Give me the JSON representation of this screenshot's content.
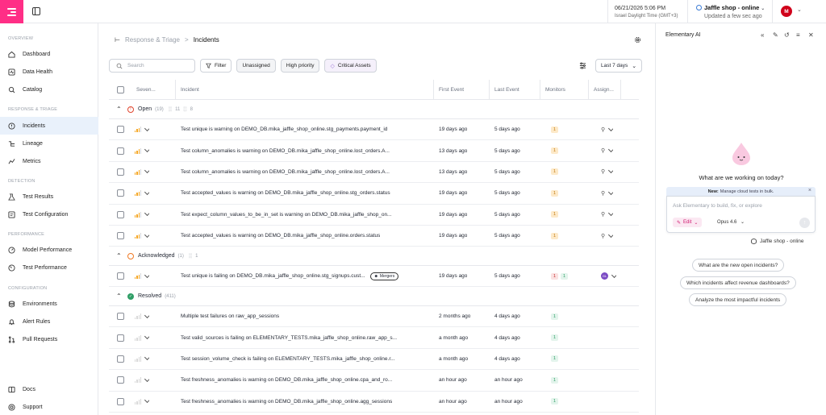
{
  "topbar": {
    "datetime": "06/21/2026 5:06 PM",
    "timezone": "Israel Daylight Time (GMT+3)",
    "env_name": "Jaffle shop - online",
    "env_updated": "Updated a few sec ago",
    "avatar_initial": "M"
  },
  "sidebar": {
    "sections": {
      "overview": "OVERVIEW",
      "response": "RESPONSE & TRIAGE",
      "detection": "DETECTION",
      "performance": "PERFORMANCE",
      "configuration": "CONFIGURATION"
    },
    "items": {
      "dashboard": "Dashboard",
      "data_health": "Data Health",
      "catalog": "Catalog",
      "incidents": "Incidents",
      "lineage": "Lineage",
      "metrics": "Metrics",
      "test_results": "Test Results",
      "test_configuration": "Test Configuration",
      "model_performance": "Model Performance",
      "test_performance": "Test Performance",
      "environments": "Environments",
      "alert_rules": "Alert Rules",
      "pull_requests": "Pull Requests",
      "docs": "Docs",
      "support": "Support"
    }
  },
  "breadcrumb": {
    "parent": "Response & Triage",
    "separator": ">",
    "current": "Incidents"
  },
  "filters": {
    "search_placeholder": "Search",
    "filter_label": "Filter",
    "unassigned": "Unassigned",
    "high_priority": "High priority",
    "critical_assets": "Critical Assets",
    "range": "Last 7 days"
  },
  "columns": {
    "severity": "Seven...",
    "incident": "Incident",
    "first_event": "First Event",
    "last_event": "Last Event",
    "monitors": "Monitors",
    "assignee": "Assign..."
  },
  "groups": {
    "open": {
      "label": "Open",
      "count": "(19)",
      "stat1": "11",
      "stat2": "8"
    },
    "acknowledged": {
      "label": "Acknowledged",
      "count": "(1)",
      "stat1": "1"
    },
    "resolved": {
      "label": "Resolved",
      "count": "(411)"
    }
  },
  "rows": [
    {
      "text": "Test unique is warning on DEMO_DB.mika_jaffle_shop_online.stg_payments.payment_id",
      "first": "19 days ago",
      "last": "5 days ago",
      "monitor": "1"
    },
    {
      "text": "Test column_anomalies is warning on DEMO_DB.mika_jaffle_shop_online.lost_orders.A...",
      "first": "13 days ago",
      "last": "5 days ago",
      "monitor": "1"
    },
    {
      "text": "Test column_anomalies is warning on DEMO_DB.mika_jaffle_shop_online.lost_orders.A...",
      "first": "13 days ago",
      "last": "5 days ago",
      "monitor": "1"
    },
    {
      "text": "Test accepted_values is warning on DEMO_DB.mika_jaffle_shop_online.stg_orders.status",
      "first": "19 days ago",
      "last": "5 days ago",
      "monitor": "1"
    },
    {
      "text": "Test expect_column_values_to_be_in_set is warning on DEMO_DB.mika_jaffle_shop_on...",
      "first": "19 days ago",
      "last": "5 days ago",
      "monitor": "1"
    },
    {
      "text": "Test accepted_values is warning on DEMO_DB.mika_jaffle_shop_online.orders.status",
      "first": "19 days ago",
      "last": "5 days ago",
      "monitor": "1"
    },
    {
      "text": "Test unique is failing on DEMO_DB.mika_jaffle_shop_online.stg_signups.cust...",
      "tag": "Mergers",
      "first": "19 days ago",
      "last": "5 days ago",
      "monitor": "1",
      "monitor2": "1",
      "assignee": "GL"
    },
    {
      "text": "Multiple test failures on raw_app_sessions",
      "first": "2 months ago",
      "last": "4 days ago",
      "monitor": "1"
    },
    {
      "text": "Test valid_sources is failing on ELEMENTARY_TESTS.mika_jaffle_shop_online.raw_app_s...",
      "first": "a month ago",
      "last": "4 days ago",
      "monitor": "1"
    },
    {
      "text": "Test session_volume_check is failing on ELEMENTARY_TESTS.mika_jaffle_shop_online.r...",
      "first": "a month ago",
      "last": "4 days ago",
      "monitor": "1"
    },
    {
      "text": "Test freshness_anomalies is warning on DEMO_DB.mika_jaffle_shop_online.cpa_and_ro...",
      "first": "an hour ago",
      "last": "an hour ago",
      "monitor": "1"
    },
    {
      "text": "Test freshness_anomalies is warning on DEMO_DB.mika_jaffle_shop_online.agg_sessions",
      "first": "an hour ago",
      "last": "an hour ago",
      "monitor": "1"
    }
  ],
  "ai": {
    "title": "Elementary AI",
    "question": "What are we working on today?",
    "new_label": "New:",
    "new_text": "Manage cloud tests in bulk.",
    "input_placeholder": "Ask Elementary to build, fix, or explore",
    "edit_label": "Edit",
    "model": "Opus 4.6",
    "context": "Jaffle shop - online",
    "suggestions": [
      "What are the new open incidents?",
      "Which incidents affect revenue dashboards?",
      "Analyze the most impactful incidents"
    ]
  },
  "colors": {
    "brand": "#ff2e86",
    "accent": "#3a7bd5",
    "warning": "#f5a623",
    "success": "#2f9e66",
    "danger": "#d0021b"
  }
}
